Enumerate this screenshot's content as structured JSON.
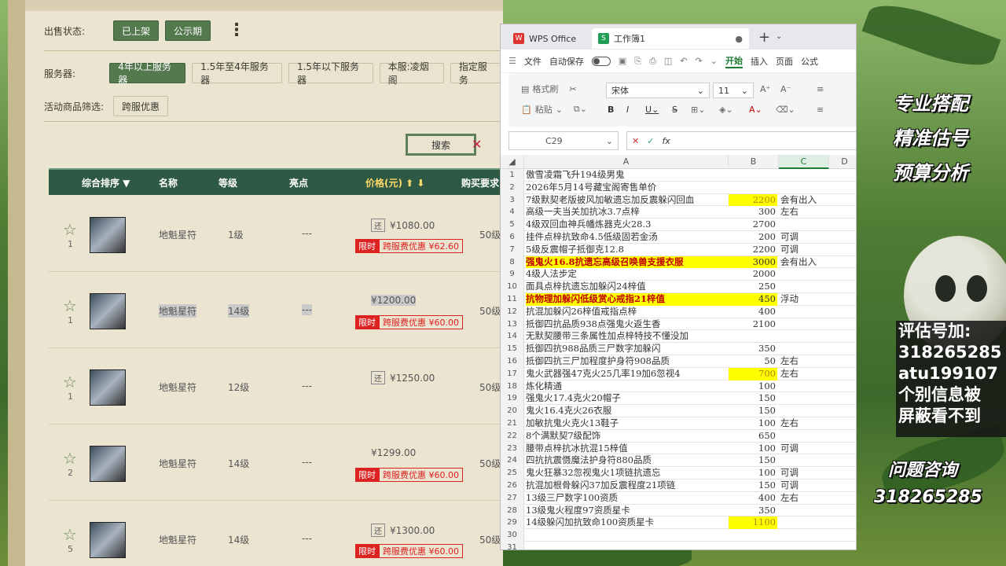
{
  "game": {
    "sale_status_label": "出售状态:",
    "sale_status_buttons": [
      "已上架",
      "公示期"
    ],
    "server_label": "服务器:",
    "server_buttons": [
      "4年以上服务器",
      "1.5年至4年服务器",
      "1.5年以下服务器",
      "本服:凌烟阁",
      "指定服务"
    ],
    "activity_label": "活动商品筛选:",
    "activity_button": "跨服优惠",
    "search_label": "搜索",
    "table_headers": [
      "综合排序 ▼",
      "名称",
      "等级",
      "亮点",
      "价格(元) ⬆ ⬇",
      "购买要求"
    ],
    "rows": [
      {
        "fav": "1",
        "name": "地魁星符",
        "level": "1级",
        "gem": "---",
        "price": "¥1080.00",
        "huan": "还",
        "promo_tag": "限时",
        "promo": "跨服费优惠 ¥62.60",
        "buy": "50级"
      },
      {
        "fav": "1",
        "name": "地魁星符",
        "level": "14级",
        "gem": "---",
        "price": "¥1200.00",
        "huan": "",
        "promo_tag": "限时",
        "promo": "跨服费优惠 ¥60.00",
        "buy": "50级"
      },
      {
        "fav": "1",
        "name": "地魁星符",
        "level": "12级",
        "gem": "---",
        "price": "¥1250.00",
        "huan": "还",
        "promo_tag": "",
        "promo": "",
        "buy": "50级"
      },
      {
        "fav": "2",
        "name": "地魁星符",
        "level": "14级",
        "gem": "---",
        "price": "¥1299.00",
        "huan": "",
        "promo_tag": "限时",
        "promo": "跨服费优惠 ¥60.00",
        "buy": "50级"
      },
      {
        "fav": "5",
        "name": "地魁星符",
        "level": "14级",
        "gem": "---",
        "price": "¥1300.00",
        "huan": "还",
        "promo_tag": "限时",
        "promo": "跨服费优惠 ¥60.00",
        "buy": "50级"
      }
    ]
  },
  "wps": {
    "tab_app": "WPS Office",
    "tab_doc": "工作簿1",
    "menu": {
      "file": "文件",
      "autosave": "自动保存",
      "start": "开始",
      "insert": "插入",
      "page": "页面",
      "formula": "公式"
    },
    "ribbon": {
      "format_painter": "格式刷",
      "paste": "粘贴",
      "font": "宋体",
      "font_size": "11"
    },
    "cell_ref": "C29",
    "fx": "fx",
    "columns": [
      "A",
      "B",
      "C",
      "D"
    ],
    "rows": [
      {
        "n": "1",
        "a": "傲雪凌霜飞升194级男鬼",
        "b": "",
        "c": ""
      },
      {
        "n": "2",
        "a": "2026年5月14号藏宝阁寄售单价",
        "b": "",
        "c": ""
      },
      {
        "n": "3",
        "a": "7级默契老版披风加敏遗忘加反震躲闪回血",
        "b": "2200",
        "c": "会有出入",
        "yb": true
      },
      {
        "n": "4",
        "a": "高级一夫当关加抗冰3.7点梓",
        "b": "300",
        "c": "左右"
      },
      {
        "n": "5",
        "a": "4级双回血神兵幡炼器克火28.3",
        "b": "2700",
        "c": ""
      },
      {
        "n": "6",
        "a": "挂件点梓抗致命4.5低级固若金汤",
        "b": "200",
        "c": "可调"
      },
      {
        "n": "7",
        "a": "5级反震帽子抵御克12.8",
        "b": "2200",
        "c": "可调"
      },
      {
        "n": "8",
        "a": "强鬼火16.8抗遗忘高级召唤兽支援衣服",
        "b": "3000",
        "c": "会有出入",
        "ya": true,
        "yb": true,
        "red": true
      },
      {
        "n": "9",
        "a": "4级人法步定",
        "b": "2000",
        "c": ""
      },
      {
        "n": "10",
        "a": "面具点梓抗遗忘加躲闪24梓值",
        "b": "250",
        "c": ""
      },
      {
        "n": "11",
        "a": "抗物理加躲闪低级赏心戒指21梓值",
        "b": "450",
        "c": "浮动",
        "ya": true,
        "yb": true,
        "red": true
      },
      {
        "n": "12",
        "a": "抗混加躲闪26梓值戒指点梓",
        "b": "400",
        "c": ""
      },
      {
        "n": "13",
        "a": "抵御四抗品质938点强鬼火返生香",
        "b": "2100",
        "c": ""
      },
      {
        "n": "14",
        "a": "无默契腰带三条属性加点梓特技不懂没加",
        "b": "",
        "c": ""
      },
      {
        "n": "15",
        "a": "抵御四抗988品质三尸数字加躲闪",
        "b": "350",
        "c": ""
      },
      {
        "n": "16",
        "a": "抵御四抗三尸加程度护身符908品质",
        "b": "50",
        "c": "左右"
      },
      {
        "n": "17",
        "a": "鬼火武器强47克火25几率19加6忽视4",
        "b": "700",
        "c": "左右",
        "yb": true
      },
      {
        "n": "18",
        "a": "炼化精通",
        "b": "100",
        "c": ""
      },
      {
        "n": "19",
        "a": "强鬼火17.4克火20帽子",
        "b": "150",
        "c": ""
      },
      {
        "n": "20",
        "a": "鬼火16.4克火26衣服",
        "b": "150",
        "c": ""
      },
      {
        "n": "21",
        "a": "加敏抗鬼火克火13鞋子",
        "b": "100",
        "c": "左右"
      },
      {
        "n": "22",
        "a": "8个满默契7级配饰",
        "b": "650",
        "c": ""
      },
      {
        "n": "23",
        "a": "腰带点梓抗冰抗混15梓值",
        "b": "100",
        "c": "可调"
      },
      {
        "n": "24",
        "a": "四抗抗震慑魔法护身符880品质",
        "b": "150",
        "c": ""
      },
      {
        "n": "25",
        "a": "鬼火狂暴32忽视鬼火1项链抗遗忘",
        "b": "100",
        "c": "可调"
      },
      {
        "n": "26",
        "a": "抗混加根骨躲闪37加反震程度21项链",
        "b": "150",
        "c": "可调"
      },
      {
        "n": "27",
        "a": "13级三尸数字100资质",
        "b": "400",
        "c": "左右"
      },
      {
        "n": "28",
        "a": "13级鬼火程度97资质星卡",
        "b": "350",
        "c": ""
      },
      {
        "n": "29",
        "a": "14级躲闪加抗致命100资质星卡",
        "b": "1100",
        "c": "",
        "yb": true,
        "active": true
      },
      {
        "n": "30",
        "a": "",
        "b": "",
        "c": ""
      },
      {
        "n": "31",
        "a": "",
        "b": "",
        "c": ""
      }
    ]
  },
  "overlay": {
    "slogans": [
      "专业搭配",
      "精准估号",
      "预算分析"
    ],
    "contact_lines": [
      "评估号加:",
      "318265285",
      "atu199107",
      "个别信息被",
      "屏蔽看不到"
    ],
    "consult_title": "问题咨询",
    "consult_number": "318265285"
  }
}
